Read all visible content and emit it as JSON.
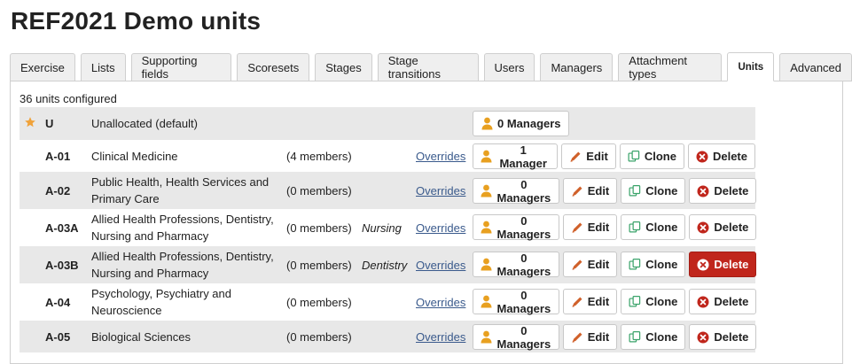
{
  "page": {
    "title": "REF2021 Demo units"
  },
  "tabs": [
    {
      "label": "Exercise",
      "active": false
    },
    {
      "label": "Lists",
      "active": false
    },
    {
      "label": "Supporting fields",
      "active": false
    },
    {
      "label": "Scoresets",
      "active": false
    },
    {
      "label": "Stages",
      "active": false
    },
    {
      "label": "Stage transitions",
      "active": false
    },
    {
      "label": "Users",
      "active": false
    },
    {
      "label": "Managers",
      "active": false
    },
    {
      "label": "Attachment types",
      "active": false
    },
    {
      "label": "Units",
      "active": true
    },
    {
      "label": "Advanced",
      "active": false
    }
  ],
  "units_count_text": "36 units configured",
  "colors": {
    "star": "#f0a23a",
    "manager_icon": "#e8a020",
    "edit_icon": "#d0602a",
    "clone_icon": "#3aa36a",
    "delete_icon": "#c0261c",
    "link": "#3a5a8c"
  },
  "icons": {
    "star": "star-icon",
    "manager": "user-icon",
    "edit": "pencil-icon",
    "clone": "copy-icon",
    "delete": "x-circle-icon"
  },
  "buttons": {
    "edit": "Edit",
    "clone": "Clone",
    "delete": "Delete"
  },
  "units": [
    {
      "code": "U",
      "name": "Unallocated (default)",
      "members": "",
      "specialism": "",
      "overrides": "",
      "managers": "0 Managers",
      "default": true
    },
    {
      "code": "A-01",
      "name": "Clinical Medicine",
      "members": "(4 members)",
      "specialism": "",
      "overrides": "Overrides",
      "managers": "1 Manager"
    },
    {
      "code": "A-02",
      "name": "Public Health, Health Services and Primary Care",
      "members": "(0 members)",
      "specialism": "",
      "overrides": "Overrides",
      "managers": "0 Managers"
    },
    {
      "code": "A-03A",
      "name": "Allied Health Professions, Dentistry, Nursing and Pharmacy",
      "members": "(0 members)",
      "specialism": "Nursing",
      "overrides": "Overrides",
      "managers": "0 Managers"
    },
    {
      "code": "A-03B",
      "name": "Allied Health Professions, Dentistry, Nursing and Pharmacy",
      "members": "(0 members)",
      "specialism": "Dentistry",
      "overrides": "Overrides",
      "managers": "0 Managers",
      "delete_active": true
    },
    {
      "code": "A-04",
      "name": "Psychology, Psychiatry and Neuroscience",
      "members": "(0 members)",
      "specialism": "",
      "overrides": "Overrides",
      "managers": "0 Managers"
    },
    {
      "code": "A-05",
      "name": "Biological Sciences",
      "members": "(0 members)",
      "specialism": "",
      "overrides": "Overrides",
      "managers": "0 Managers"
    }
  ]
}
